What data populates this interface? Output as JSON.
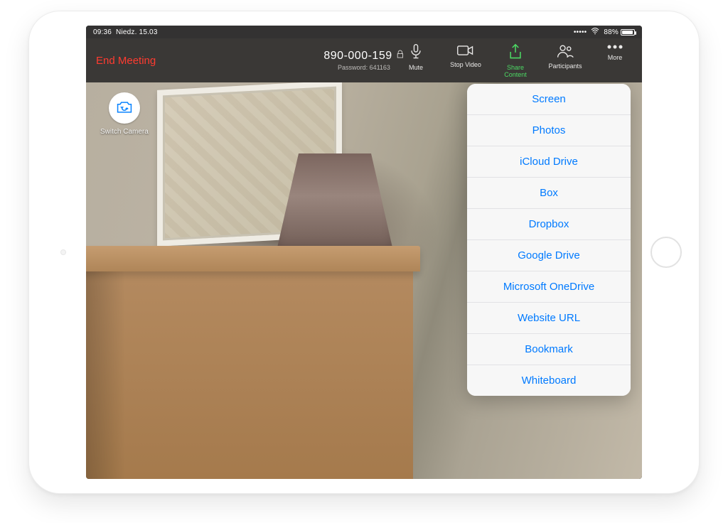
{
  "status": {
    "time": "09:36",
    "date": "Niedz. 15.03",
    "battery_pct": "88%"
  },
  "topbar": {
    "end_label": "End Meeting",
    "meeting_id": "890-000-159",
    "password_label": "Password: 641163",
    "mute_label": "Mute",
    "stop_video_label": "Stop Video",
    "share_label": "Share Content",
    "participants_label": "Participants",
    "more_label": "More"
  },
  "switch_camera_label": "Switch Camera",
  "share_menu": {
    "items": [
      "Screen",
      "Photos",
      "iCloud Drive",
      "Box",
      "Dropbox",
      "Google Drive",
      "Microsoft OneDrive",
      "Website URL",
      "Bookmark",
      "Whiteboard"
    ]
  }
}
